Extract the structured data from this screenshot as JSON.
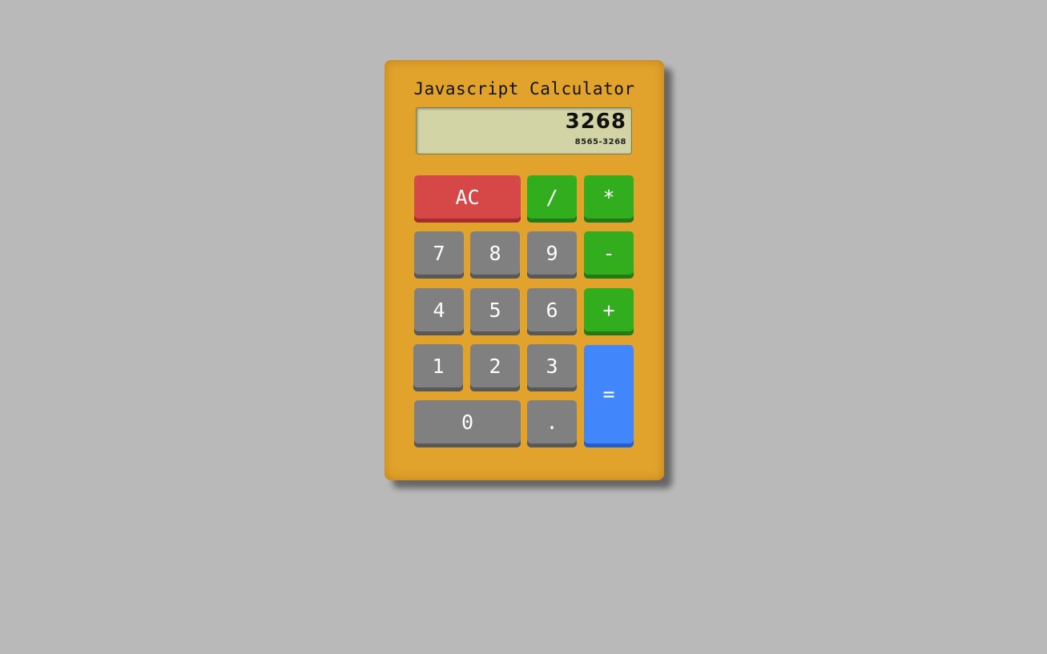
{
  "calculator": {
    "title": "Javascript Calculator",
    "display": {
      "value": "3268",
      "formula": "8565-3268"
    },
    "keys": {
      "clear": "AC",
      "divide": "/",
      "multiply": "*",
      "subtract": "-",
      "add": "+",
      "equals": "=",
      "decimal": ".",
      "seven": "7",
      "eight": "8",
      "nine": "9",
      "four": "4",
      "five": "5",
      "six": "6",
      "one": "1",
      "two": "2",
      "three": "3",
      "zero": "0"
    },
    "colors": {
      "body": "#e1a32b",
      "display": "#d3d4a6",
      "number_key": "#808080",
      "operator_key": "#32ad1e",
      "clear_key": "#d64848",
      "equals_key": "#4286fb",
      "background": "#b9b9b9"
    }
  }
}
